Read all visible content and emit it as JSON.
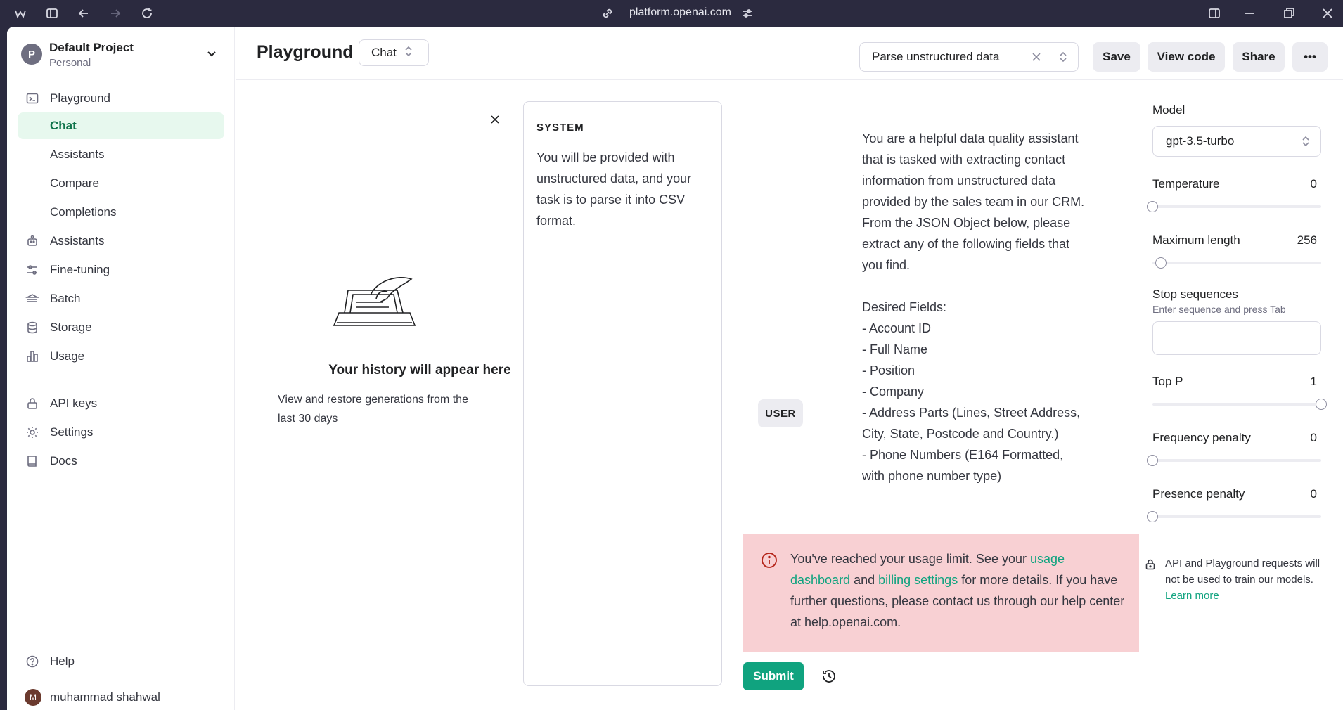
{
  "browser": {
    "url": "platform.openai.com"
  },
  "sidebar": {
    "project_name": "Default Project",
    "project_type": "Personal",
    "project_initial": "P",
    "items": [
      {
        "label": "Playground",
        "icon": "terminal-icon"
      },
      {
        "label": "Chat",
        "active": true
      },
      {
        "label": "Assistants"
      },
      {
        "label": "Compare"
      },
      {
        "label": "Completions"
      },
      {
        "label": "Assistants",
        "icon": "robot-icon"
      },
      {
        "label": "Fine-tuning",
        "icon": "sliders-icon"
      },
      {
        "label": "Batch",
        "icon": "layers-icon"
      },
      {
        "label": "Storage",
        "icon": "database-icon"
      },
      {
        "label": "Usage",
        "icon": "bar-chart-icon"
      },
      {
        "label": "API keys",
        "icon": "lock-icon"
      },
      {
        "label": "Settings",
        "icon": "gear-icon"
      },
      {
        "label": "Docs",
        "icon": "book-icon"
      }
    ],
    "help_label": "Help",
    "user_name": "muhammad shahwal",
    "user_initial": "M"
  },
  "header": {
    "title": "Playground",
    "mode": "Chat",
    "preset": "Parse unstructured data",
    "save_label": "Save",
    "view_code_label": "View code",
    "share_label": "Share",
    "more_label": "•••"
  },
  "history": {
    "title": "Your history will appear here",
    "subtitle": "View and restore generations from the last 30 days"
  },
  "system": {
    "label": "SYSTEM",
    "text": "You will be provided with unstructured data, and your task is to parse it into CSV format."
  },
  "conversation": {
    "role": "USER",
    "message": "You are a helpful data quality assistant that is tasked with extracting contact information from unstructured data provided by the sales team in our CRM. From the JSON Object below, please extract any of the following fields that you find.\n\nDesired Fields:\n- Account ID\n- Full Name\n- Position\n- Company\n- Address Parts (Lines, Street Address, City, State, Postcode and Country.)\n- Phone Numbers (E164 Formatted, with phone number type)"
  },
  "alert": {
    "text_1": "You've reached your usage limit. See your ",
    "link_1": "usage dashboard",
    "text_2": " and ",
    "link_2": "billing settings",
    "text_3": " for more details. If you have further questions, please contact us through our help center at help.openai.com."
  },
  "submit_label": "Submit",
  "settings": {
    "model_label": "Model",
    "model_value": "gpt-3.5-turbo",
    "temperature_label": "Temperature",
    "temperature_value": "0",
    "temperature_level": 0.0,
    "max_length_label": "Maximum length",
    "max_length_value": "256",
    "max_length_level": 0.05,
    "stop_label": "Stop sequences",
    "stop_hint": "Enter sequence and press Tab",
    "top_p_label": "Top P",
    "top_p_value": "1",
    "top_p_level": 1.0,
    "freq_label": "Frequency penalty",
    "freq_value": "0",
    "freq_level": 0.0,
    "presence_label": "Presence penalty",
    "presence_value": "0",
    "presence_level": 0.0,
    "privacy_text": "API and Playground requests will not be used to train our models.",
    "privacy_link": "Learn more"
  },
  "colors": {
    "accent": "#10a37f",
    "active_bg": "#e7f8ee",
    "alert_bg": "#f8d0d3",
    "chrome_bg": "#2b2a3f"
  }
}
